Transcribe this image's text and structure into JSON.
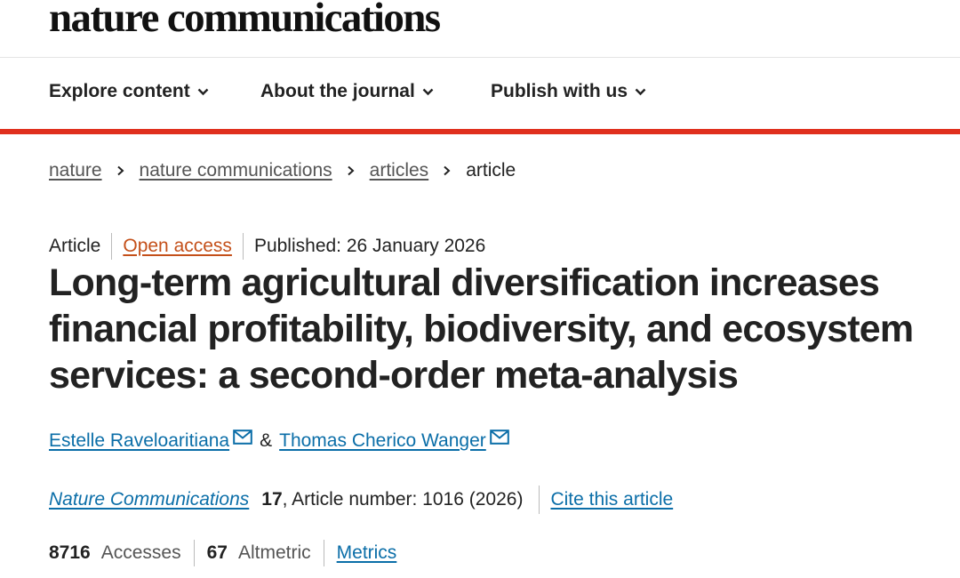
{
  "masthead": {
    "logo": "nature communications"
  },
  "nav": {
    "items": [
      {
        "label": "Explore content"
      },
      {
        "label": "About the journal"
      },
      {
        "label": "Publish with us"
      }
    ]
  },
  "breadcrumb": {
    "links": [
      "nature",
      "nature communications",
      "articles"
    ],
    "current": "article"
  },
  "article": {
    "type": "Article",
    "access": "Open access",
    "published": "Published: 26 January 2026",
    "title": "Long-term agricultural diversification increases financial profitability, biodiversity, and ecosystem services: a second-order meta-analysis",
    "authors": [
      "Estelle Raveloaritiana",
      "Thomas Cherico Wanger"
    ],
    "author_joiner": "&",
    "journal": "Nature Communications",
    "volume": "17",
    "article_number": ", Article number: 1016 (2026)",
    "cite_label": "Cite this article"
  },
  "metrics": {
    "accesses_value": "8716",
    "accesses_label": "Accesses",
    "altmetric_value": "67",
    "altmetric_label": "Altmetric",
    "metrics_link": "Metrics"
  },
  "colors": {
    "accent_rule": "#e0301e",
    "link": "#0b6ea8",
    "open_access": "#c4501a"
  },
  "icons": {
    "nav_chevron": "chevron-down-icon",
    "breadcrumb_separator": "chevron-right-icon",
    "author_contact": "mail-icon"
  }
}
